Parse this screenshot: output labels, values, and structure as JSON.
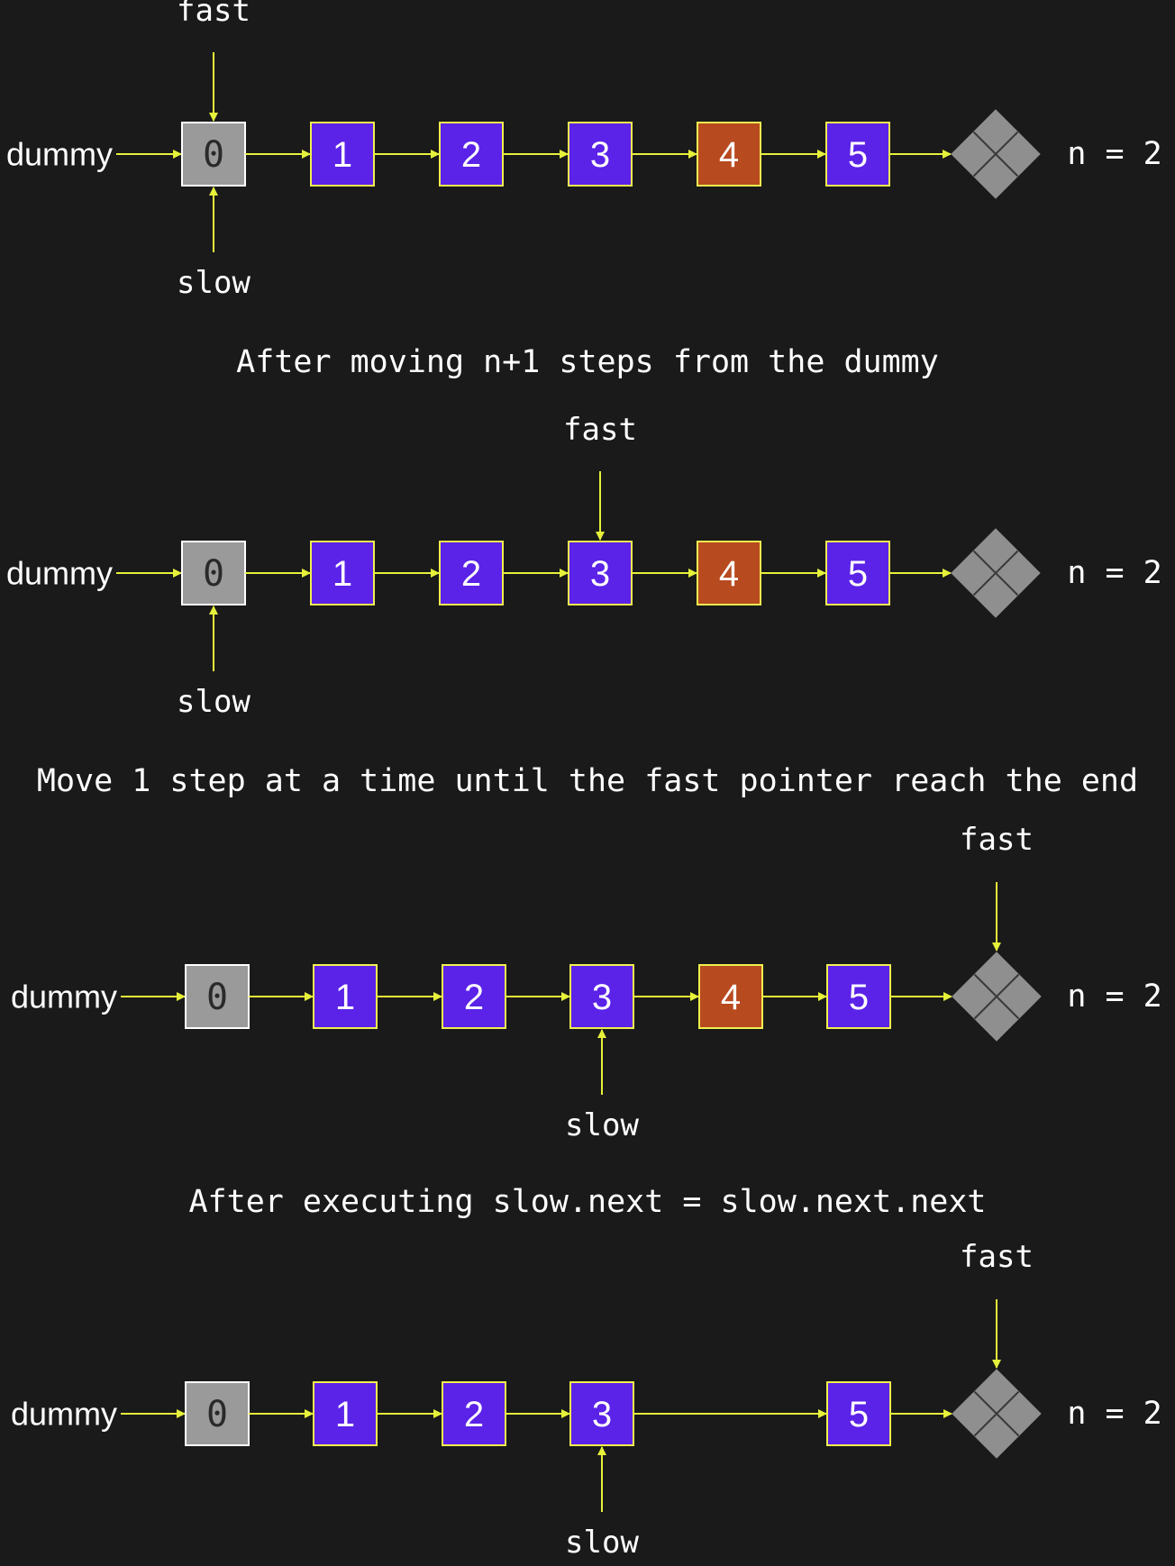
{
  "colors": {
    "background": "#1a1a1a",
    "arrow": "#e6f23a",
    "node_fill": "#5b22e8",
    "node_border": "#f0f050",
    "highlight_fill": "#b84a1f",
    "dummy_fill": "#9a9a9a",
    "dummy_border": "#ffffff",
    "null_fill": "#8f8f8f",
    "null_line": "#3a3a3a"
  },
  "labels": {
    "dummy": "dummy",
    "fast": "fast",
    "slow": "slow",
    "n": "n = 2"
  },
  "captions": [
    "After moving n+1 steps from the dummy",
    "Move 1 step at a time until the fast pointer reach the end",
    "After executing slow.next = slow.next.next"
  ],
  "null_icon": "null-terminator-diamond-icon",
  "stages": [
    {
      "nodes": [
        {
          "value": "0",
          "kind": "dummy"
        },
        {
          "value": "1",
          "kind": "normal"
        },
        {
          "value": "2",
          "kind": "normal"
        },
        {
          "value": "3",
          "kind": "normal"
        },
        {
          "value": "4",
          "kind": "target"
        },
        {
          "value": "5",
          "kind": "normal"
        }
      ],
      "fast_at": 0,
      "slow_at": 0
    },
    {
      "nodes": [
        {
          "value": "0",
          "kind": "dummy"
        },
        {
          "value": "1",
          "kind": "normal"
        },
        {
          "value": "2",
          "kind": "normal"
        },
        {
          "value": "3",
          "kind": "normal"
        },
        {
          "value": "4",
          "kind": "target"
        },
        {
          "value": "5",
          "kind": "normal"
        }
      ],
      "fast_at": 3,
      "slow_at": 0
    },
    {
      "nodes": [
        {
          "value": "0",
          "kind": "dummy"
        },
        {
          "value": "1",
          "kind": "normal"
        },
        {
          "value": "2",
          "kind": "normal"
        },
        {
          "value": "3",
          "kind": "normal"
        },
        {
          "value": "4",
          "kind": "target"
        },
        {
          "value": "5",
          "kind": "normal"
        }
      ],
      "fast_at": "null",
      "slow_at": 3
    },
    {
      "nodes": [
        {
          "value": "0",
          "kind": "dummy"
        },
        {
          "value": "1",
          "kind": "normal"
        },
        {
          "value": "2",
          "kind": "normal"
        },
        {
          "value": "3",
          "kind": "normal"
        },
        {
          "value": "5",
          "kind": "normal"
        }
      ],
      "fast_at": "null",
      "slow_at": 3
    }
  ]
}
